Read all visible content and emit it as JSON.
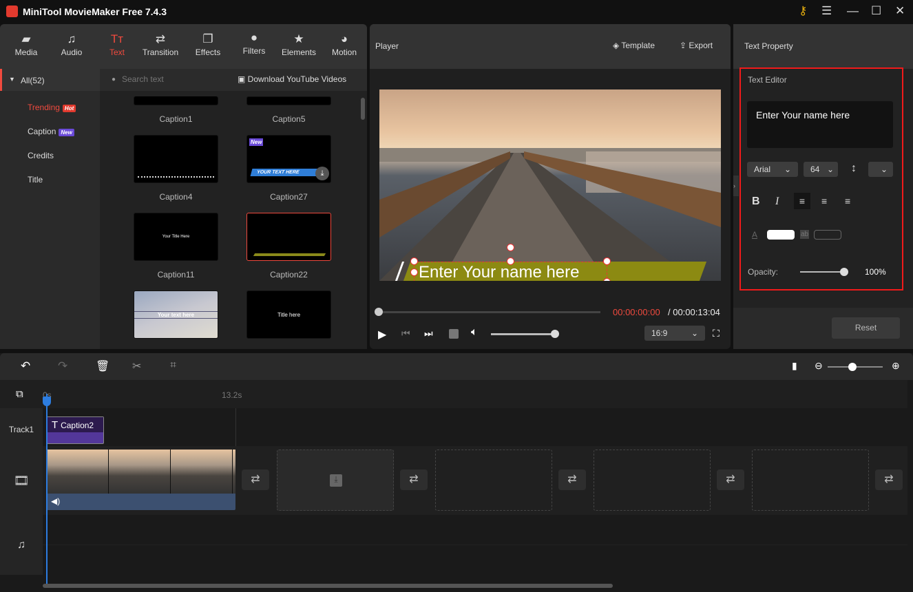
{
  "app": {
    "title": "MiniTool MovieMaker Free 7.4.3",
    "key_icon": "key-icon"
  },
  "tabs": [
    {
      "label": "Media",
      "icon": "folder-icon"
    },
    {
      "label": "Audio",
      "icon": "music-icon"
    },
    {
      "label": "Text",
      "icon": "text-icon",
      "active": true
    },
    {
      "label": "Transition",
      "icon": "transition-icon"
    },
    {
      "label": "Effects",
      "icon": "effects-icon"
    },
    {
      "label": "Filters",
      "icon": "filters-icon"
    },
    {
      "label": "Elements",
      "icon": "elements-icon"
    },
    {
      "label": "Motion",
      "icon": "motion-icon"
    }
  ],
  "categories": {
    "all": "All(52)",
    "items": [
      {
        "label": "Trending",
        "badge": "Hot",
        "active": true
      },
      {
        "label": "Caption",
        "badge": "New"
      },
      {
        "label": "Credits"
      },
      {
        "label": "Title"
      }
    ]
  },
  "search": {
    "placeholder": "Search text",
    "download": "Download YouTube Videos"
  },
  "templates": [
    {
      "name": "Caption1"
    },
    {
      "name": "Caption5"
    },
    {
      "name": "Caption4"
    },
    {
      "name": "Caption27",
      "badge": "New",
      "preview": "YOUR TEXT HERE"
    },
    {
      "name": "Caption11",
      "preview": "Your Title Here"
    },
    {
      "name": "Caption22",
      "selected": true
    },
    {
      "name": "",
      "preview": "Your text here"
    },
    {
      "name": "",
      "preview": "Title here"
    }
  ],
  "player": {
    "title": "Player",
    "template": "Template",
    "export": "Export",
    "overlay_text": "Enter Your name here",
    "current": "00:00:00:00",
    "total": "/ 00:00:13:04",
    "aspect": "16:9",
    "progress": 0,
    "volume": 1.0
  },
  "text_property": {
    "title": "Text Property",
    "section": "Text Editor",
    "text": "Enter Your name here",
    "font": "Arial",
    "size": "64",
    "text_color": "#ffffff",
    "opacity_label": "Opacity:",
    "opacity": "100%",
    "reset": "Reset"
  },
  "timeline": {
    "start": "0s",
    "end": "13.2s",
    "track": "Track1",
    "clip": "Caption2"
  },
  "colors": {
    "accent": "#f04a3e",
    "highlight": "#f21a1a",
    "playhead": "#2d7de0",
    "caption_clip": "#5a3a9c"
  }
}
